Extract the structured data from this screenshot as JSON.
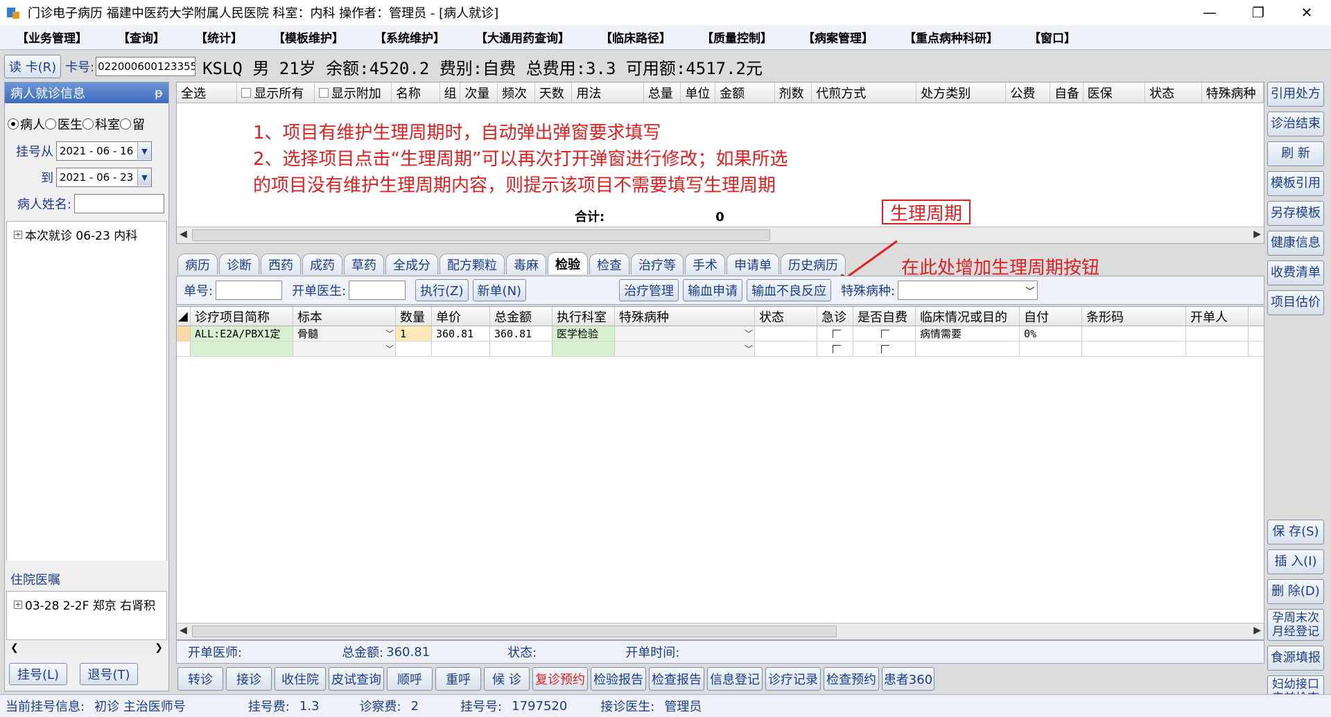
{
  "window": {
    "title": "门诊电子病历  福建中医药大学附属人民医院  科室：内科  操作者：管理员 - [病人就诊]",
    "minimize": "—",
    "restore": "❐",
    "close": "✕"
  },
  "menu": [
    "【业务管理】",
    "【查询】",
    "【统计】",
    "【模板维护】",
    "【系统维护】",
    "【大通用药查询】",
    "【临床路径】",
    "【质量控制】",
    "【病案管理】",
    "【重点病种科研】",
    "【窗口】"
  ],
  "infobar": {
    "read_card": "读 卡(R)",
    "card_label": "卡号:",
    "card_no": "022000600123355(",
    "summary": "KSLQ 男 21岁 余额:4520.2 费别:自费 总费用:3.3 可用额:4517.2元"
  },
  "left": {
    "header": "病人就诊信息",
    "pin": "ᵽ",
    "radios": [
      "病人",
      "医生",
      "科室",
      "留"
    ],
    "date_from_label": "挂号从",
    "date_from": "2021 - 06 - 16",
    "date_to_label": "到",
    "date_to": "2021 - 06 - 23",
    "name_label": "病人姓名:",
    "tree_item": "本次就诊 06-23 内科",
    "inpatient_header": "住院医嘱",
    "inpatient_item": "03-28 2-2F 郑京 右肾积",
    "register_btn": "挂号(L)",
    "unregister_btn": "退号(T)"
  },
  "rx": {
    "columns": [
      "全选",
      "显示所有",
      "显示附加",
      "名称",
      "组",
      "次量",
      "频次",
      "天数",
      "用法",
      "总量",
      "单位",
      "金额",
      "剂数",
      "代煎方式",
      "处方类别",
      "公费",
      "自备",
      "医保",
      "状态",
      "特殊病种"
    ],
    "annotation_line1": "1、项目有维护生理周期时，自动弹出弹窗要求填写",
    "annotation_line2": "2、选择项目点击“生理周期”可以再次打开弹窗进行修改；如果所选",
    "annotation_line3": "的项目没有维护生理周期内容，则提示该项目不需要填写生理周期",
    "total_label": "合计:",
    "total_value": "0"
  },
  "annotations": {
    "lifecycle_box": "生理周期",
    "add_button_note": "在此处增加生理周期按钮",
    "color": "#e02020"
  },
  "tabs": [
    "病历",
    "诊断",
    "西药",
    "成药",
    "草药",
    "全成分",
    "配方颗粒",
    "毒麻",
    "检验",
    "检查",
    "治疗等",
    "手术",
    "申请单",
    "历史病历"
  ],
  "active_tab": "检验",
  "detail_toolbar": {
    "order_no_label": "单号:",
    "doctor_label": "开单医生:",
    "execute_btn": "执行(Z)",
    "new_btn": "新单(N)",
    "treatment_btn": "治疗管理",
    "transfusion_btn": "输血申请",
    "adverse_btn": "输血不良反应",
    "special_label": "特殊病种:"
  },
  "detail_grid": {
    "columns": [
      "诊疗项目简称",
      "标本",
      "数量",
      "单价",
      "总金额",
      "执行科室",
      "特殊病种",
      "状态",
      "急诊",
      "是否自费",
      "临床情况或目的",
      "自付",
      "条形码",
      "开单人"
    ],
    "rows": [
      {
        "name": "ALL:E2A/PBX1定",
        "specimen": "骨髓",
        "qty": "1",
        "price": "360.81",
        "total": "360.81",
        "dept": "医学检验",
        "special": "",
        "status": "",
        "clinical": "病情需要",
        "selfpay": "0%",
        "barcode": "",
        "issuer": ""
      }
    ]
  },
  "bottom_summary": {
    "doctor_label": "开单医师:",
    "total_label": "总金额:",
    "total_value": "360.81",
    "status_label": "状态:",
    "time_label": "开单时间:"
  },
  "bottom_actions": [
    "转诊",
    "接诊",
    "收住院",
    "皮试查询",
    "顺呼",
    "重呼",
    "候 诊",
    "复诊预约",
    "检验报告",
    "检查报告",
    "信息登记",
    "诊疗记录",
    "检查预约",
    "患者360"
  ],
  "right_buttons_top": [
    "引用处方",
    "诊治结束",
    "刷 新",
    "模板引用",
    "另存模板",
    "健康信息",
    "收费清单",
    "项目估价"
  ],
  "right_buttons_bottom": [
    "保 存(S)",
    "插 入(I)",
    "删 除(D)",
    "孕周末次月经登记",
    "食源填报",
    "妇幼接口产前检查"
  ],
  "statusbar": {
    "current_label": "当前挂号信息:",
    "visit_type": "初诊 主治医师号",
    "reg_fee_label": "挂号费:",
    "reg_fee": "1.3",
    "consult_fee_label": "诊察费:",
    "consult_fee": "2",
    "reg_no_label": "挂号号:",
    "reg_no": "1797520",
    "doctor_label": "接诊医生:",
    "doctor": "管理员"
  }
}
